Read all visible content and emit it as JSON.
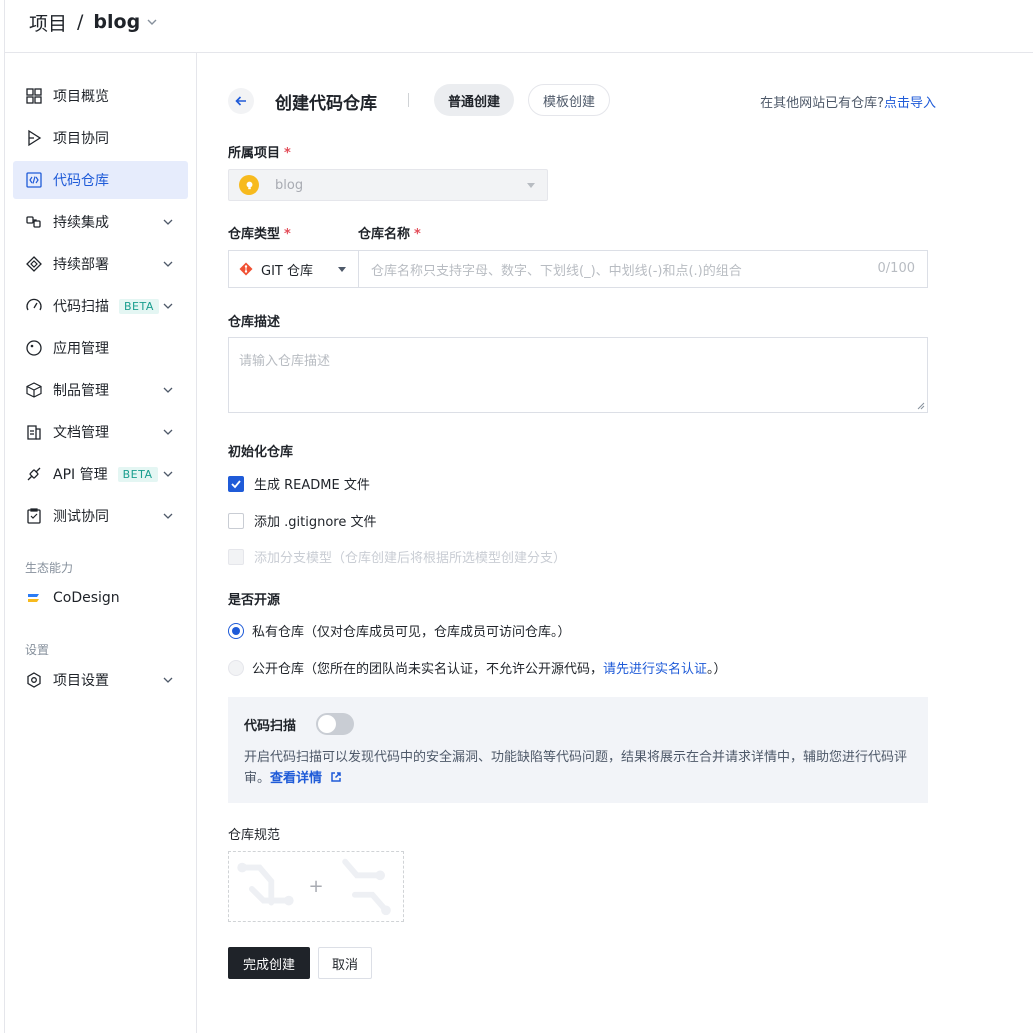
{
  "header": {
    "breadcrumb_root": "项目",
    "breadcrumb_sep": "/",
    "project_name": "blog"
  },
  "sidebar": {
    "items": [
      {
        "label": "项目概览",
        "icon": "overview-grid-icon"
      },
      {
        "label": "项目协同",
        "icon": "collaboration-play-icon"
      },
      {
        "label": "代码仓库",
        "icon": "code-icon",
        "active": true
      },
      {
        "label": "持续集成",
        "icon": "ci-icon"
      },
      {
        "label": "持续部署",
        "icon": "deploy-icon"
      },
      {
        "label": "代码扫描",
        "icon": "scan-gauge-icon",
        "badge": "BETA"
      },
      {
        "label": "应用管理",
        "icon": "app-icon"
      },
      {
        "label": "制品管理",
        "icon": "package-cube-icon"
      },
      {
        "label": "文档管理",
        "icon": "document-icon"
      },
      {
        "label": "API 管理",
        "icon": "api-icon",
        "badge": "BETA"
      },
      {
        "label": "测试协同",
        "icon": "test-clipboard-icon"
      }
    ],
    "section_ecosystem": "生态能力",
    "codesign": "CoDesign",
    "section_settings": "设置",
    "project_settings": "项目设置",
    "accent": "#1f5bd8"
  },
  "main": {
    "title": "创建代码仓库",
    "tab_normal": "普通创建",
    "tab_template": "模板创建",
    "import_prefix": "在其他网站已有仓库?",
    "import_link": "点击导入",
    "project_label": "所属项目",
    "project_value": "blog",
    "repo_type_label": "仓库类型",
    "repo_type_value": "GIT 仓库",
    "repo_name_label": "仓库名称",
    "repo_name_placeholder": "仓库名称只支持字母、数字、下划线(_)、中划线(-)和点(.)的组合",
    "repo_name_count": "0/100",
    "desc_label": "仓库描述",
    "desc_placeholder": "请输入仓库描述",
    "init_label": "初始化仓库",
    "init_readme": "生成 README 文件",
    "init_gitignore": "添加 .gitignore 文件",
    "init_branch_model": "添加分支模型（仓库创建后将根据所选模型创建分支）",
    "open_source_label": "是否开源",
    "private_option": "私有仓库（仅对仓库成员可见，仓库成员可访问仓库。）",
    "public_option_prefix": "公开仓库（您所在的团队尚未实名认证，不允许公开源代码，",
    "public_option_link": "请先进行实名认证",
    "public_option_suffix": "。）",
    "scan_title": "代码扫描",
    "scan_enabled": false,
    "scan_desc": "开启代码扫描可以发现代码中的安全漏洞、功能缺陷等代码问题，结果将展示在合并请求详情中，辅助您进行代码评审。",
    "scan_link": "查看详情",
    "spec_label": "仓库规范",
    "upload_plus": "+",
    "submit": "完成创建",
    "cancel": "取消"
  }
}
